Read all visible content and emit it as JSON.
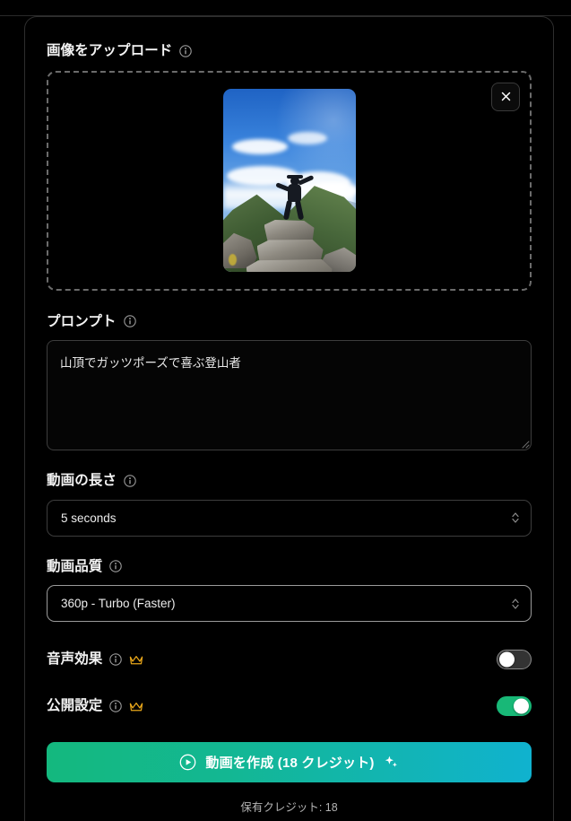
{
  "upload": {
    "label": "画像をアップロード",
    "info_icon": "info-icon",
    "remove_icon": "close-icon",
    "remove_label": "✕",
    "image_alt": "山頂の岩の上でガッツポーズをする登山者"
  },
  "prompt": {
    "label": "プロンプト",
    "value": "山頂でガッツポーズで喜ぶ登山者",
    "placeholder": ""
  },
  "duration": {
    "label": "動画の長さ",
    "value": "5 seconds"
  },
  "quality": {
    "label": "動画品質",
    "value": "360p - Turbo (Faster)"
  },
  "sound_effects": {
    "label": "音声効果",
    "premium_icon": "crown-icon",
    "enabled": false
  },
  "visibility": {
    "label": "公開設定",
    "premium_icon": "crown-icon",
    "enabled": true
  },
  "generate": {
    "label": "動画を作成 (18 クレジット)",
    "play_icon": "play-circle-icon",
    "sparkle_icon": "sparkle-icon"
  },
  "footer": {
    "credits_text": "保有クレジット: 18"
  },
  "colors": {
    "background": "#000000",
    "accent_green": "#14b87e",
    "accent_cyan": "#10b2cf",
    "toggle_on": "#18b877",
    "crown_gold": "#e8a61a",
    "border": "#3d3d3d"
  }
}
